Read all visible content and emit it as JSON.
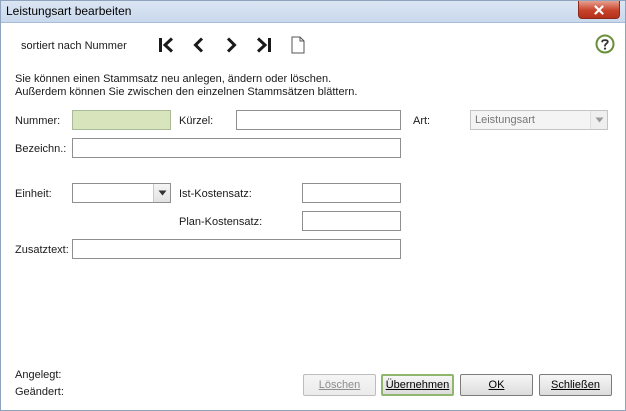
{
  "window": {
    "title": "Leistungsart bearbeiten"
  },
  "toolbar": {
    "sort_label": "sortiert nach Nummer",
    "icons": [
      "first-record-icon",
      "previous-record-icon",
      "next-record-icon",
      "last-record-icon",
      "new-document-icon",
      "help-icon"
    ]
  },
  "info": {
    "line1": "Sie können einen Stammsatz neu anlegen, ändern oder löschen.",
    "line2": "Außerdem können Sie zwischen den einzelnen Stammsätzen blättern."
  },
  "form": {
    "nummer_label": "Nummer:",
    "nummer_value": "",
    "kuerzel_label": "Kürzel:",
    "kuerzel_value": "",
    "art_label": "Art:",
    "art_value": "Leistungsart",
    "bezeichnung_label": "Bezeichn.:",
    "bezeichnung_value": "",
    "einheit_label": "Einheit:",
    "einheit_value": "",
    "ist_kostensatz_label": "Ist-Kostensatz:",
    "ist_kostensatz_value": "",
    "plan_kostensatz_label": "Plan-Kostensatz:",
    "plan_kostensatz_value": "",
    "zusatztext_label": "Zusatztext:",
    "zusatztext_value": ""
  },
  "footer": {
    "angelegt_label": "Angelegt:",
    "geaendert_label": "Geändert:"
  },
  "buttons": {
    "loeschen": "Löschen",
    "uebernehmen": "Übernehmen",
    "ok": "OK",
    "schliessen": "Schließen"
  },
  "colors": {
    "nummer_field_bg": "#d8e5bc",
    "close_button": "#c7432b",
    "help_icon": "#6a8f3a"
  }
}
